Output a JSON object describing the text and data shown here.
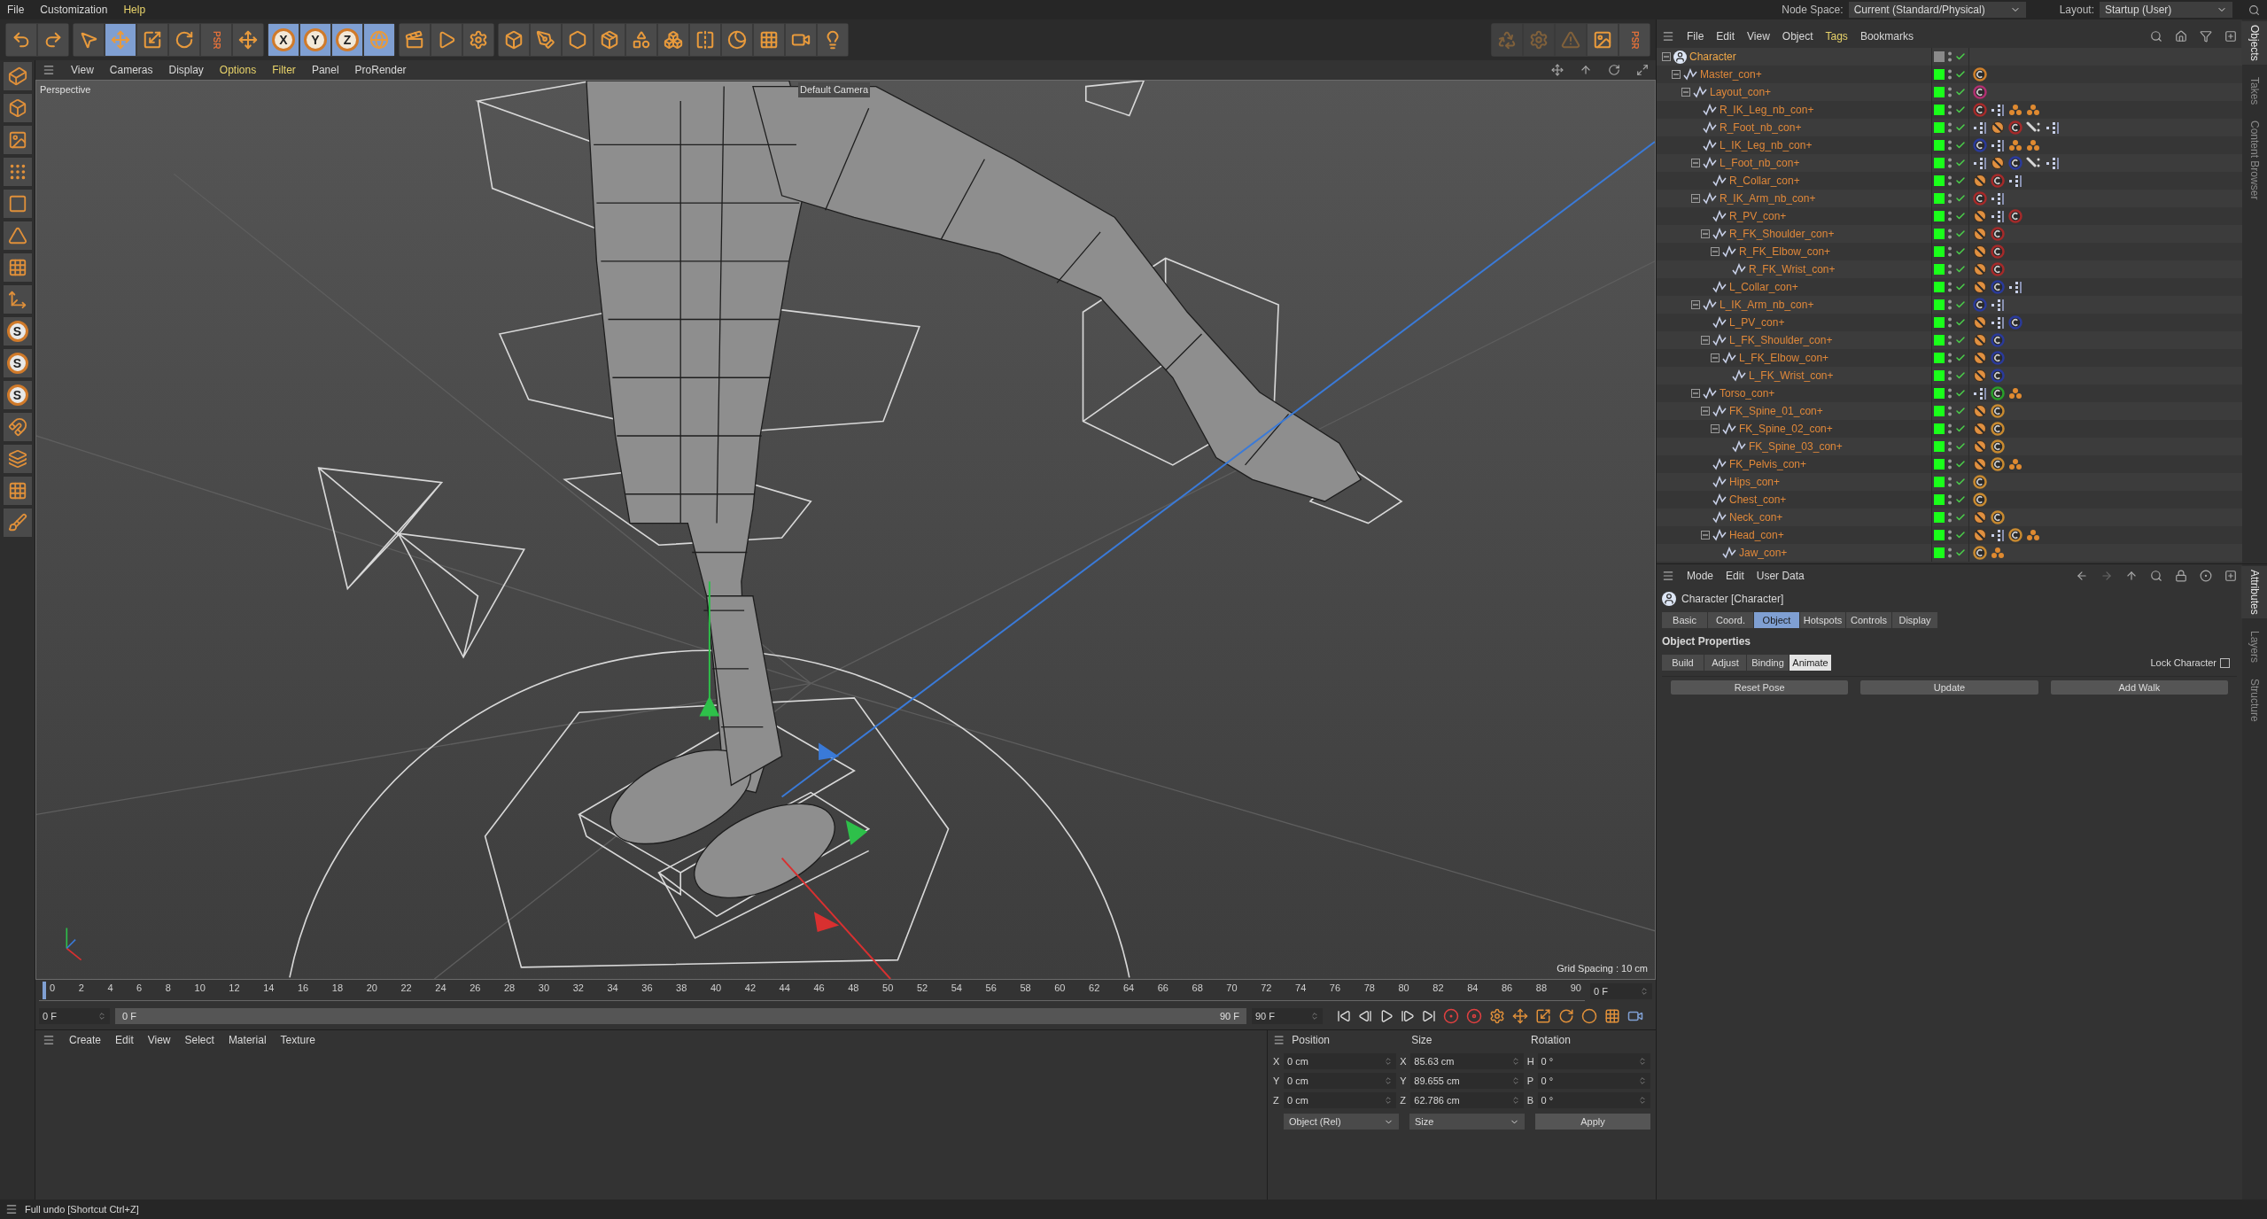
{
  "menu_bar": {
    "items": [
      {
        "label": "File",
        "highlighted": false
      },
      {
        "label": "Customization",
        "highlighted": false
      },
      {
        "label": "Help",
        "highlighted": true
      }
    ],
    "node_space": {
      "label": "Node Space:",
      "value": "Current (Standard/Physical)"
    },
    "layout": {
      "label": "Layout:",
      "value": "Startup (User)"
    }
  },
  "toolbar": [
    {
      "kind": "undo",
      "selected": false
    },
    {
      "kind": "redo",
      "selected": false
    },
    {
      "kind": "sep"
    },
    {
      "kind": "select",
      "selected": false
    },
    {
      "kind": "move",
      "selected": true
    },
    {
      "kind": "scale",
      "selected": false
    },
    {
      "kind": "rotate",
      "selected": false
    },
    {
      "kind": "psr",
      "label": "PSR",
      "selected": false
    },
    {
      "kind": "axis-move",
      "selected": false
    },
    {
      "kind": "sep"
    },
    {
      "kind": "axis",
      "label": "X",
      "selected": true
    },
    {
      "kind": "axis",
      "label": "Y",
      "selected": true
    },
    {
      "kind": "axis",
      "label": "Z",
      "selected": true
    },
    {
      "kind": "world",
      "selected": true
    },
    {
      "kind": "sep"
    },
    {
      "kind": "render-view",
      "selected": false
    },
    {
      "kind": "render",
      "selected": false
    },
    {
      "kind": "render-settings",
      "selected": false
    },
    {
      "kind": "sep"
    },
    {
      "kind": "cube",
      "selected": false
    },
    {
      "kind": "pen",
      "selected": false
    },
    {
      "kind": "subdivision",
      "selected": false
    },
    {
      "kind": "extrude",
      "selected": false
    },
    {
      "kind": "polygons",
      "selected": false
    },
    {
      "kind": "cloner",
      "selected": false
    },
    {
      "kind": "symmetry",
      "selected": false
    },
    {
      "kind": "deformer",
      "selected": false
    },
    {
      "kind": "floor",
      "selected": false
    },
    {
      "kind": "camera",
      "selected": false
    },
    {
      "kind": "light",
      "selected": false
    }
  ],
  "toolbar_right": [
    {
      "kind": "recycle",
      "disabled": true
    },
    {
      "kind": "settings",
      "disabled": true
    },
    {
      "kind": "warning",
      "disabled": true
    },
    {
      "kind": "render-region",
      "disabled": false
    },
    {
      "kind": "psr",
      "label": "PSR",
      "disabled": false
    }
  ],
  "left_tools": [
    {
      "kind": "editable"
    },
    {
      "kind": "model"
    },
    {
      "kind": "texture"
    },
    {
      "kind": "points"
    },
    {
      "kind": "edges"
    },
    {
      "kind": "polygons"
    },
    {
      "kind": "uv"
    },
    {
      "kind": "axis"
    },
    {
      "kind": "letter",
      "label": "S"
    },
    {
      "kind": "letter",
      "label": "S"
    },
    {
      "kind": "letter",
      "label": "S"
    },
    {
      "kind": "magnet"
    },
    {
      "kind": "floor"
    },
    {
      "kind": "grid"
    },
    {
      "kind": "paint"
    }
  ],
  "viewport": {
    "menu": [
      {
        "label": "View",
        "highlighted": false
      },
      {
        "label": "Cameras",
        "highlighted": false
      },
      {
        "label": "Display",
        "highlighted": false
      },
      {
        "label": "Options",
        "highlighted": true
      },
      {
        "label": "Filter",
        "highlighted": true
      },
      {
        "label": "Panel",
        "highlighted": false
      },
      {
        "label": "ProRender",
        "highlighted": false
      }
    ],
    "camera_label": "Perspective",
    "default_camera": "Default Camera",
    "grid_spacing": "Grid Spacing : 10 cm"
  },
  "timeline": {
    "ticks": [
      "0",
      "2",
      "4",
      "6",
      "8",
      "10",
      "12",
      "14",
      "16",
      "18",
      "20",
      "22",
      "24",
      "26",
      "28",
      "30",
      "32",
      "34",
      "36",
      "38",
      "40",
      "42",
      "44",
      "46",
      "48",
      "50",
      "52",
      "54",
      "56",
      "58",
      "60",
      "62",
      "64",
      "66",
      "68",
      "70",
      "72",
      "74",
      "76",
      "78",
      "80",
      "82",
      "84",
      "86",
      "88",
      "90"
    ],
    "level": 0,
    "current_frame": "0 F",
    "start_field": "0 F",
    "range": {
      "start": "0 F",
      "end": "90 F",
      "level": 1
    },
    "end_field": "90 F"
  },
  "material_manager": {
    "menu": [
      "Create",
      "Edit",
      "View",
      "Select",
      "Material",
      "Texture"
    ]
  },
  "coordinates": {
    "headers": [
      "Position",
      "Size",
      "Rotation"
    ],
    "rows": [
      {
        "position_axis": "X",
        "position": "0 cm",
        "size_axis": "X",
        "size": "85.63 cm",
        "rotation_axis": "H",
        "rotation": "0 °"
      },
      {
        "position_axis": "Y",
        "position": "0 cm",
        "size_axis": "Y",
        "size": "89.655 cm",
        "rotation_axis": "P",
        "rotation": "0 °"
      },
      {
        "position_axis": "Z",
        "position": "0 cm",
        "size_axis": "Z",
        "size": "62.786 cm",
        "rotation_axis": "B",
        "rotation": "0 °"
      }
    ],
    "mode": "Object (Rel)",
    "size_mode": "Size",
    "apply": "Apply"
  },
  "status_bar": "Full undo [Shortcut Ctrl+Z]",
  "object_manager": {
    "menu": [
      {
        "label": "File",
        "highlighted": false
      },
      {
        "label": "Edit",
        "highlighted": false
      },
      {
        "label": "View",
        "highlighted": false
      },
      {
        "label": "Object",
        "highlighted": false
      },
      {
        "label": "Tags",
        "highlighted": true
      },
      {
        "label": "Bookmarks",
        "highlighted": false
      }
    ],
    "side_tabs": [
      {
        "label": "Objects",
        "selected": true
      },
      {
        "label": "Takes",
        "selected": false
      },
      {
        "label": "Content Browser",
        "selected": false
      }
    ],
    "tree": [
      {
        "name": "Character",
        "kind": "character",
        "enabled": false,
        "expanded": true,
        "children": [
          {
            "name": "Master_con+",
            "kind": "spline",
            "enabled": true,
            "expanded": true,
            "tags": [
              {
                "kind": "constraint",
                "color": "#d0802a"
              }
            ],
            "children": [
              {
                "name": "Layout_con+",
                "kind": "spline",
                "enabled": true,
                "expanded": true,
                "tags": [
                  {
                    "kind": "constraint",
                    "color": "#b03070"
                  }
                ],
                "children": [
                  {
                    "name": "R_IK_Leg_nb_con+",
                    "kind": "spline",
                    "enabled": true,
                    "tags": [
                      {
                        "kind": "constraint",
                        "color": "#a52a2a"
                      },
                      {
                        "kind": "tree"
                      },
                      {
                        "kind": "cluster"
                      },
                      {
                        "kind": "cluster"
                      }
                    ]
                  },
                  {
                    "name": "R_Foot_nb_con+",
                    "kind": "spline",
                    "enabled": true,
                    "tags": [
                      {
                        "kind": "tree"
                      },
                      {
                        "kind": "protection"
                      },
                      {
                        "kind": "constraint",
                        "color": "#a52a2a"
                      },
                      {
                        "kind": "bone"
                      },
                      {
                        "kind": "tree"
                      }
                    ]
                  },
                  {
                    "name": "L_IK_Leg_nb_con+",
                    "kind": "spline",
                    "enabled": true,
                    "tags": [
                      {
                        "kind": "constraint",
                        "color": "#2a3a9a"
                      },
                      {
                        "kind": "tree"
                      },
                      {
                        "kind": "cluster"
                      },
                      {
                        "kind": "cluster"
                      }
                    ]
                  },
                  {
                    "name": "L_Foot_nb_con+",
                    "kind": "spline",
                    "enabled": true,
                    "expanded": true,
                    "tags": [
                      {
                        "kind": "tree"
                      },
                      {
                        "kind": "protection"
                      },
                      {
                        "kind": "constraint",
                        "color": "#2a3a9a"
                      },
                      {
                        "kind": "bone"
                      },
                      {
                        "kind": "tree"
                      }
                    ],
                    "children": [
                      {
                        "name": "R_Collar_con+",
                        "kind": "spline",
                        "enabled": true,
                        "tags": [
                          {
                            "kind": "protection"
                          },
                          {
                            "kind": "constraint",
                            "color": "#a52a2a"
                          },
                          {
                            "kind": "tree"
                          }
                        ]
                      }
                    ]
                  },
                  {
                    "name": "R_IK_Arm_nb_con+",
                    "kind": "spline",
                    "enabled": true,
                    "expanded": true,
                    "tags": [
                      {
                        "kind": "constraint",
                        "color": "#a52a2a"
                      },
                      {
                        "kind": "tree"
                      }
                    ],
                    "children": [
                      {
                        "name": "R_PV_con+",
                        "kind": "spline",
                        "enabled": true,
                        "tags": [
                          {
                            "kind": "protection"
                          },
                          {
                            "kind": "tree"
                          },
                          {
                            "kind": "constraint",
                            "color": "#a52a2a"
                          }
                        ]
                      },
                      {
                        "name": "R_FK_Shoulder_con+",
                        "kind": "spline",
                        "enabled": true,
                        "expanded": true,
                        "tags": [
                          {
                            "kind": "protection"
                          },
                          {
                            "kind": "constraint",
                            "color": "#a52a2a"
                          }
                        ],
                        "children": [
                          {
                            "name": "R_FK_Elbow_con+",
                            "kind": "spline",
                            "enabled": true,
                            "expanded": true,
                            "tags": [
                              {
                                "kind": "protection"
                              },
                              {
                                "kind": "constraint",
                                "color": "#a52a2a"
                              }
                            ],
                            "children": [
                              {
                                "name": "R_FK_Wrist_con+",
                                "kind": "spline",
                                "enabled": true,
                                "tags": [
                                  {
                                    "kind": "protection"
                                  },
                                  {
                                    "kind": "constraint",
                                    "color": "#a52a2a"
                                  }
                                ]
                              }
                            ]
                          }
                        ]
                      },
                      {
                        "name": "L_Collar_con+",
                        "kind": "spline",
                        "enabled": true,
                        "tags": [
                          {
                            "kind": "protection"
                          },
                          {
                            "kind": "constraint",
                            "color": "#2a3a9a"
                          },
                          {
                            "kind": "tree"
                          }
                        ]
                      }
                    ]
                  },
                  {
                    "name": "L_IK_Arm_nb_con+",
                    "kind": "spline",
                    "enabled": true,
                    "expanded": true,
                    "tags": [
                      {
                        "kind": "constraint",
                        "color": "#2a3a9a"
                      },
                      {
                        "kind": "tree"
                      }
                    ],
                    "children": [
                      {
                        "name": "L_PV_con+",
                        "kind": "spline",
                        "enabled": true,
                        "tags": [
                          {
                            "kind": "protection"
                          },
                          {
                            "kind": "tree"
                          },
                          {
                            "kind": "constraint",
                            "color": "#2a3a9a"
                          }
                        ]
                      },
                      {
                        "name": "L_FK_Shoulder_con+",
                        "kind": "spline",
                        "enabled": true,
                        "expanded": true,
                        "tags": [
                          {
                            "kind": "protection"
                          },
                          {
                            "kind": "constraint",
                            "color": "#2a3a9a"
                          }
                        ],
                        "children": [
                          {
                            "name": "L_FK_Elbow_con+",
                            "kind": "spline",
                            "enabled": true,
                            "expanded": true,
                            "tags": [
                              {
                                "kind": "protection"
                              },
                              {
                                "kind": "constraint",
                                "color": "#2a3a9a"
                              }
                            ],
                            "children": [
                              {
                                "name": "L_FK_Wrist_con+",
                                "kind": "spline",
                                "enabled": true,
                                "tags": [
                                  {
                                    "kind": "protection"
                                  },
                                  {
                                    "kind": "constraint",
                                    "color": "#2a3a9a"
                                  }
                                ]
                              }
                            ]
                          }
                        ]
                      }
                    ]
                  },
                  {
                    "name": "Torso_con+",
                    "kind": "spline",
                    "enabled": true,
                    "expanded": true,
                    "tags": [
                      {
                        "kind": "tree"
                      },
                      {
                        "kind": "constraint",
                        "color": "#2aa02a"
                      },
                      {
                        "kind": "cluster"
                      }
                    ],
                    "children": [
                      {
                        "name": "FK_Spine_01_con+",
                        "kind": "spline",
                        "enabled": true,
                        "expanded": true,
                        "tags": [
                          {
                            "kind": "protection"
                          },
                          {
                            "kind": "constraint",
                            "color": "#c88a30"
                          }
                        ],
                        "children": [
                          {
                            "name": "FK_Spine_02_con+",
                            "kind": "spline",
                            "enabled": true,
                            "expanded": true,
                            "tags": [
                              {
                                "kind": "protection"
                              },
                              {
                                "kind": "constraint",
                                "color": "#c88a30"
                              }
                            ],
                            "children": [
                              {
                                "name": "FK_Spine_03_con+",
                                "kind": "spline",
                                "enabled": true,
                                "tags": [
                                  {
                                    "kind": "protection"
                                  },
                                  {
                                    "kind": "constraint",
                                    "color": "#c88a30"
                                  }
                                ]
                              }
                            ]
                          }
                        ]
                      },
                      {
                        "name": "FK_Pelvis_con+",
                        "kind": "spline",
                        "enabled": true,
                        "tags": [
                          {
                            "kind": "protection"
                          },
                          {
                            "kind": "constraint",
                            "color": "#c88a30"
                          },
                          {
                            "kind": "cluster"
                          }
                        ]
                      },
                      {
                        "name": "Hips_con+",
                        "kind": "spline",
                        "enabled": true,
                        "tags": [
                          {
                            "kind": "constraint",
                            "color": "#c88a30"
                          }
                        ]
                      },
                      {
                        "name": "Chest_con+",
                        "kind": "spline",
                        "enabled": true,
                        "tags": [
                          {
                            "kind": "constraint",
                            "color": "#c88a30"
                          }
                        ]
                      },
                      {
                        "name": "Neck_con+",
                        "kind": "spline",
                        "enabled": true,
                        "tags": [
                          {
                            "kind": "protection"
                          },
                          {
                            "kind": "constraint",
                            "color": "#c88a30"
                          }
                        ]
                      },
                      {
                        "name": "Head_con+",
                        "kind": "spline",
                        "enabled": true,
                        "expanded": true,
                        "tags": [
                          {
                            "kind": "protection"
                          },
                          {
                            "kind": "tree"
                          },
                          {
                            "kind": "constraint",
                            "color": "#c88a30"
                          },
                          {
                            "kind": "cluster"
                          }
                        ],
                        "children": [
                          {
                            "name": "Jaw_con+",
                            "kind": "spline",
                            "enabled": true,
                            "tags": [
                              {
                                "kind": "constraint",
                                "color": "#c88a30"
                              },
                              {
                                "kind": "cluster"
                              }
                            ]
                          }
                        ]
                      }
                    ]
                  }
                ]
              }
            ]
          }
        ]
      }
    ]
  },
  "attributes": {
    "menu": [
      "Mode",
      "Edit",
      "User Data"
    ],
    "title": "Character [Character]",
    "tabs": [
      {
        "label": "Basic",
        "selected": false
      },
      {
        "label": "Coord.",
        "selected": false
      },
      {
        "label": "Object",
        "selected": true
      },
      {
        "label": "Hotspots",
        "selected": false
      },
      {
        "label": "Controls",
        "selected": false
      },
      {
        "label": "Display",
        "selected": false
      }
    ],
    "section": "Object Properties",
    "subtabs": [
      {
        "label": "Build",
        "selected": false
      },
      {
        "label": "Adjust",
        "selected": false
      },
      {
        "label": "Binding",
        "selected": false
      },
      {
        "label": "Animate",
        "selected": true
      }
    ],
    "lock": {
      "label": "Lock Character",
      "checked": false
    },
    "buttons": [
      "Reset Pose",
      "Update",
      "Add Walk"
    ],
    "side_tabs": [
      {
        "label": "Attributes",
        "selected": true
      },
      {
        "label": "Layers",
        "selected": false
      },
      {
        "label": "Structure",
        "selected": false
      }
    ]
  }
}
